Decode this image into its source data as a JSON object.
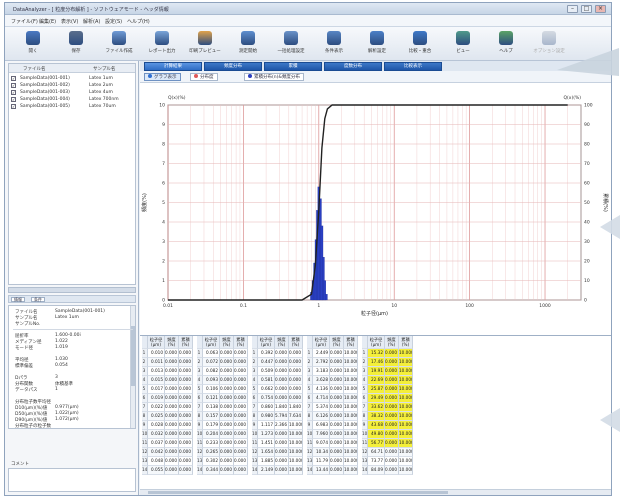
{
  "window": {
    "title": "DataAnalyzer - [ 粒度分布解析 ] - ソフトウェアモード - ヘッダ情報",
    "controls": [
      "–",
      "□",
      "×"
    ]
  },
  "menu": [
    "ファイル(F)",
    "編集(E)",
    "表示(V)",
    "解析(A)",
    "設定(S)",
    "ヘルプ(H)"
  ],
  "toolbar": [
    {
      "label": "開く",
      "icon": "folder-icon",
      "color": "#4a79c2",
      "enabled": true
    },
    {
      "label": "保存",
      "icon": "save-icon",
      "color": "#5a6e8c",
      "enabled": true
    },
    {
      "label": "ファイル作成",
      "icon": "new-file-icon",
      "color": "#6f9bd6",
      "enabled": true
    },
    {
      "label": "レポート出力",
      "icon": "report-icon",
      "color": "#79a4d8",
      "enabled": true
    },
    {
      "label": "印刷プレビュー",
      "icon": "print-icon",
      "color": "#e0a24a",
      "enabled": true
    },
    {
      "label": "測定開始",
      "icon": "measure-icon",
      "color": "#5e8fcf",
      "enabled": true
    },
    {
      "label": "一括処理設定",
      "icon": "batch-icon",
      "color": "#6a93c9",
      "enabled": true
    },
    {
      "label": "条件表示",
      "icon": "condition-icon",
      "color": "#5986c4",
      "enabled": true
    },
    {
      "label": "解析設定",
      "icon": "settings-icon",
      "color": "#4c80c8",
      "enabled": true
    },
    {
      "label": "比較・重合",
      "icon": "compare-icon",
      "color": "#3f79c8",
      "enabled": true
    },
    {
      "label": "ビュー",
      "icon": "view-icon",
      "color": "#4f9a8a",
      "enabled": true
    },
    {
      "label": "ヘルプ",
      "icon": "help-icon",
      "color": "#5ba366",
      "enabled": true
    },
    {
      "label": "オプション設定",
      "icon": "option-icon",
      "color": "#9aa6b5",
      "enabled": false
    }
  ],
  "file_list": {
    "headers": [
      "ファイル名",
      "サンプル名"
    ],
    "rows": [
      {
        "checked": true,
        "file": "SampleData(001-001)",
        "sample": "Latex 1um"
      },
      {
        "checked": true,
        "file": "SampleData(001-002)",
        "sample": "Latex 2um"
      },
      {
        "checked": true,
        "file": "SampleData(001-003)",
        "sample": "Latex 4um"
      },
      {
        "checked": true,
        "file": "SampleData(001-004)",
        "sample": "Latex 700nm"
      },
      {
        "checked": true,
        "file": "SampleData(001-005)",
        "sample": "Latex 70um"
      }
    ]
  },
  "mini_tabs": [
    "情報",
    "条件"
  ],
  "properties": {
    "top": [
      {
        "k": "ファイル名",
        "v": "SampleData(001-001)"
      },
      {
        "k": "サンプル名",
        "v": "Latex 1um"
      },
      {
        "k": "サンプルNo.",
        "v": ""
      }
    ],
    "bottom": [
      {
        "k": "屈折率",
        "v": "1.600-0.00i"
      },
      {
        "k": "メディアン径",
        "v": "1.022"
      },
      {
        "k": "モード径",
        "v": "1.019"
      },
      {
        "k": "",
        "v": ""
      },
      {
        "k": "平均径",
        "v": "1.030"
      },
      {
        "k": "標準偏差",
        "v": "0.054"
      },
      {
        "k": "",
        "v": ""
      },
      {
        "k": "Dパラ",
        "v": "3"
      },
      {
        "k": "分布関数",
        "v": "体積基準"
      },
      {
        "k": "データパス",
        "v": "1"
      },
      {
        "k": "",
        "v": ""
      },
      {
        "k": "分布粒子数平均径",
        "v": ""
      },
      {
        "k": "D10(μm)(%)値",
        "v": "0.977(μm)"
      },
      {
        "k": "D50(μm)(%)値",
        "v": "1.022(μm)"
      },
      {
        "k": "D90(μm)(%)値",
        "v": "1.072(μm)"
      },
      {
        "k": "分布粒子の粒子数",
        "v": ""
      }
    ]
  },
  "comment_label": "コメント",
  "tabs": [
    "計算結果",
    "頻度分布",
    "累積",
    "度数分布",
    "比較表示"
  ],
  "subtabs": [
    {
      "label": "グラフ表示",
      "color": "#2f6fd1",
      "active": true
    },
    {
      "label": "分布度",
      "color": "#e05a5a",
      "active": false
    },
    {
      "label": "累積分布(n)&頻度分布",
      "color": "#2b3fbf",
      "active": false
    }
  ],
  "chart_data": {
    "type": "bar",
    "xlabel": "粒子径(μm)",
    "ylabel_left": "頻度(%)",
    "ylabel_right": "累積(%)",
    "left_axis_title": "Q(x)(%)",
    "right_axis_title": "Q(x)(%)",
    "x_scale": "log",
    "xlim": [
      0.01,
      3000
    ],
    "x_ticks": [
      0.01,
      0.1,
      1,
      10,
      100,
      1000
    ],
    "x_tick_labels": [
      "0.01",
      "0.1",
      "1",
      "10",
      "100",
      "1000"
    ],
    "ylim_left": [
      0,
      10
    ],
    "ylim_right": [
      0,
      100
    ],
    "y_ticks_left": [
      "0",
      "1",
      "2",
      "3",
      "4",
      "5",
      "6",
      "7",
      "8",
      "9",
      "10"
    ],
    "y_ticks_right": [
      "0",
      "10",
      "20",
      "30",
      "40",
      "50",
      "60",
      "70",
      "80",
      "90",
      "100"
    ],
    "grid": true,
    "series": [
      {
        "kind": "bar",
        "color": "#2a3fc2",
        "x": [
          0.8,
          0.84,
          0.88,
          0.92,
          0.96,
          1.0,
          1.05,
          1.1,
          1.15,
          1.2,
          1.26
        ],
        "y": [
          0.4,
          1.0,
          1.9,
          3.1,
          4.6,
          5.8,
          5.2,
          3.8,
          2.2,
          1.0,
          0.3
        ]
      },
      {
        "kind": "line",
        "color": "#222222",
        "x": [
          0.01,
          0.6,
          0.8,
          0.9,
          1.0,
          1.1,
          1.2,
          1.3,
          1.5,
          2000
        ],
        "y": [
          0,
          0,
          3,
          18,
          46,
          78,
          93,
          98,
          100,
          100
        ]
      }
    ]
  },
  "table": {
    "group_headers": [
      "粒子径\n(μm)",
      "頻度\n(%)",
      "累積\n(%)"
    ],
    "row_count": 14,
    "groups": [
      {
        "x": [
          "0.010",
          "0.011",
          "0.013",
          "0.015",
          "0.017",
          "0.019",
          "0.022",
          "0.025",
          "0.028",
          "0.032",
          "0.037",
          "0.042",
          "0.048",
          "0.055"
        ],
        "f": [
          "0.000",
          "0.000",
          "0.000",
          "0.000",
          "0.000",
          "0.000",
          "0.000",
          "0.000",
          "0.000",
          "0.000",
          "0.000",
          "0.000",
          "0.000",
          "0.000"
        ],
        "c": [
          "0.000",
          "0.000",
          "0.000",
          "0.000",
          "0.000",
          "0.000",
          "0.000",
          "0.000",
          "0.000",
          "0.000",
          "0.000",
          "0.000",
          "0.000",
          "0.000"
        ]
      },
      {
        "x": [
          "0.063",
          "0.072",
          "0.082",
          "0.093",
          "0.106",
          "0.121",
          "0.138",
          "0.157",
          "0.179",
          "0.204",
          "0.233",
          "0.265",
          "0.302",
          "0.344"
        ],
        "f": [
          "0.000",
          "0.000",
          "0.000",
          "0.000",
          "0.000",
          "0.000",
          "0.000",
          "0.000",
          "0.000",
          "0.000",
          "0.000",
          "0.000",
          "0.000",
          "0.000"
        ],
        "c": [
          "0.000",
          "0.000",
          "0.000",
          "0.000",
          "0.000",
          "0.000",
          "0.000",
          "0.000",
          "0.000",
          "0.000",
          "0.000",
          "0.000",
          "0.000",
          "0.000"
        ]
      },
      {
        "x": [
          "0.392",
          "0.447",
          "0.509",
          "0.581",
          "0.662",
          "0.754",
          "0.860",
          "0.980",
          "1.117",
          "1.273",
          "1.451",
          "1.654",
          "1.885",
          "2.149"
        ],
        "f": [
          "0.000",
          "0.000",
          "0.000",
          "0.000",
          "0.000",
          "0.000",
          "1.840",
          "5.794",
          "2.366",
          "0.000",
          "0.000",
          "0.000",
          "0.000",
          "0.000"
        ],
        "c": [
          "0.000",
          "0.000",
          "0.000",
          "0.000",
          "0.000",
          "0.000",
          "1.840",
          "7.634",
          "10.000",
          "10.000",
          "10.000",
          "10.000",
          "10.000",
          "10.000"
        ]
      },
      {
        "x": [
          "2.449",
          "2.792",
          "3.183",
          "3.628",
          "4.136",
          "4.714",
          "5.374",
          "6.126",
          "6.983",
          "7.960",
          "9.074",
          "10.34",
          "11.79",
          "13.44"
        ],
        "f": [
          "0.000",
          "0.000",
          "0.000",
          "0.000",
          "0.000",
          "0.000",
          "0.000",
          "0.000",
          "0.000",
          "0.000",
          "0.000",
          "0.000",
          "0.000",
          "0.000"
        ],
        "c": [
          "10.000",
          "10.000",
          "10.000",
          "10.000",
          "10.000",
          "10.000",
          "10.000",
          "10.000",
          "10.000",
          "10.000",
          "10.000",
          "10.000",
          "10.000",
          "10.000"
        ]
      },
      {
        "x": [
          "15.32",
          "17.46",
          "19.91",
          "22.69",
          "25.87",
          "29.49",
          "33.62",
          "38.32",
          "43.68",
          "49.80",
          "56.77",
          "64.71",
          "73.77",
          "84.09"
        ],
        "f": [
          "0.000",
          "0.000",
          "0.000",
          "0.000",
          "0.000",
          "0.000",
          "0.000",
          "0.000",
          "0.000",
          "0.000",
          "0.000",
          "0.000",
          "0.000",
          "0.000"
        ],
        "c": [
          "10.000",
          "10.000",
          "10.000",
          "10.000",
          "10.000",
          "10.000",
          "10.000",
          "10.000",
          "10.000",
          "10.000",
          "10.000",
          "10.000",
          "10.000",
          "10.000"
        ]
      }
    ],
    "highlight_group": 4,
    "highlight_rows": [
      0,
      1,
      2,
      3,
      4,
      5,
      6,
      7,
      8,
      9,
      10
    ],
    "highlight_color": "#f4ef3a"
  }
}
